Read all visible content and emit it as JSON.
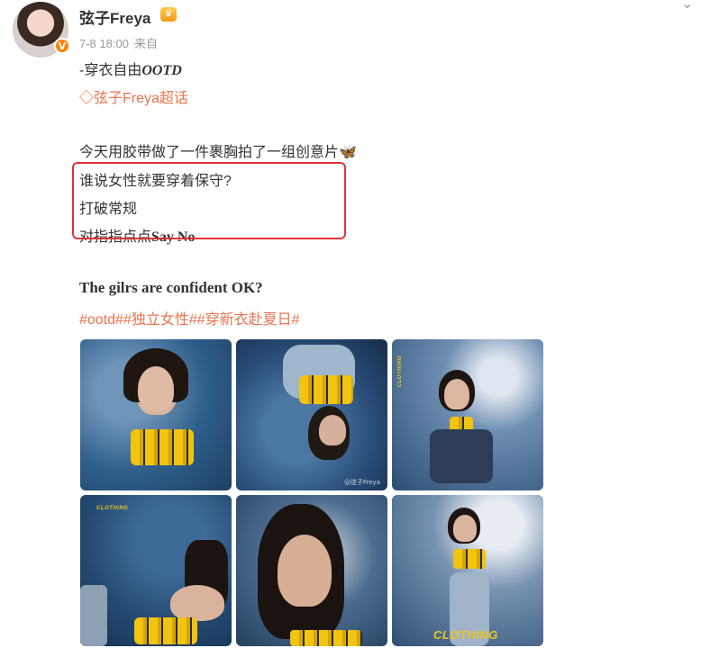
{
  "post": {
    "username": "弦子Freya",
    "verified_badge": "V",
    "crown_icon": "crown-icon",
    "date": "7-8 18:00",
    "source_prefix": "来自",
    "title_prefix": "-穿衣自由",
    "title_emph": "OOTD",
    "topic_link": "弦子Freya超话",
    "line1": "今天用胶带做了一件裹胸拍了一组创意片",
    "butterfly": "🦋",
    "line2": "谁说女性就要穿着保守?",
    "line3": "打破常规",
    "line4_cn": "对指指点点",
    "line4_en": "Say No",
    "line5": "The gilrs are confident OK?",
    "hashtags": "#ootd##独立女性##穿新衣赴夏日#",
    "chevron": "⌄"
  },
  "photos": {
    "captions": [
      "CLOTHING",
      "CLOTHING"
    ],
    "watermark": "@弦子Freya"
  },
  "colors": {
    "link": "#eb7350",
    "highlight": "#e0323c",
    "vbadge": "#ff8200"
  }
}
